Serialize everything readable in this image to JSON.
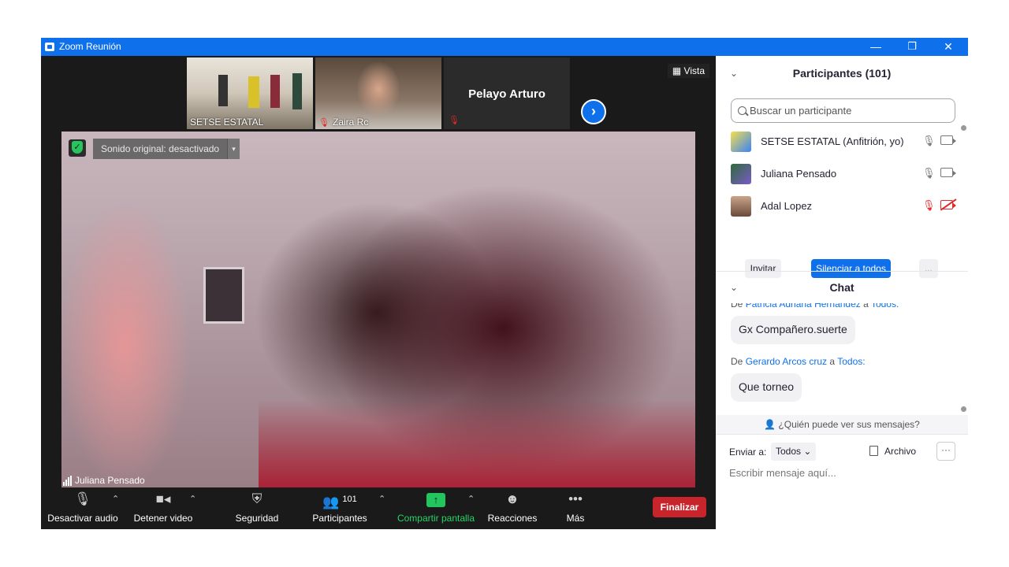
{
  "window": {
    "title": "Zoom Reunión",
    "minimize": "—",
    "restore": "❐",
    "close": "✕"
  },
  "thumbnails": [
    {
      "name": "SETSE ESTATAL"
    },
    {
      "name": "Zaira Rc"
    },
    {
      "name": "Pelayo Arturo"
    }
  ],
  "vista_label": "Vista",
  "main_video": {
    "sound_label": "Sonido original: desactivado",
    "speaker_name": "Juliana Pensado"
  },
  "toolbar": {
    "audio_label": "Desactivar audio",
    "video_label": "Detener video",
    "security_label": "Seguridad",
    "participants_label": "Participantes",
    "participants_count": "101",
    "share_label": "Compartir pantalla",
    "reactions_label": "Reacciones",
    "more_label": "Más",
    "end_label": "Finalizar"
  },
  "participants_panel": {
    "title": "Participantes (101)",
    "search_placeholder": "Buscar un participante",
    "items": [
      {
        "name": "SETSE ESTATAL (Anfitrión, yo)",
        "muted": false,
        "video_off": false
      },
      {
        "name": "Juliana Pensado",
        "muted": false,
        "video_off": false
      },
      {
        "name": "Adal Lopez",
        "muted": true,
        "video_off": true
      }
    ],
    "invite_label": "Invitar",
    "mute_all_label": "Silenciar a todos",
    "more_label": "..."
  },
  "chat_panel": {
    "title": "Chat",
    "messages": [
      {
        "prefix": "De",
        "from": "Patricia Adriana Hernandez",
        "mid": "a",
        "to": "Todos:",
        "text": "Gx Compañero.suerte"
      },
      {
        "prefix": "De",
        "from": "Gerardo Arcos cruz",
        "mid": "a",
        "to": "Todos:",
        "text": "Que torneo"
      }
    ],
    "who_sees": "¿Quién puede ver sus mensajes?",
    "send_to_label": "Enviar a:",
    "send_to_value": "Todos",
    "file_label": "Archivo",
    "input_placeholder": "Escribir mensaje aquí..."
  },
  "colors": {
    "accent": "#0e71eb",
    "end_red": "#c8242b",
    "share_green": "#22c55e",
    "muted_red": "#e02828"
  }
}
